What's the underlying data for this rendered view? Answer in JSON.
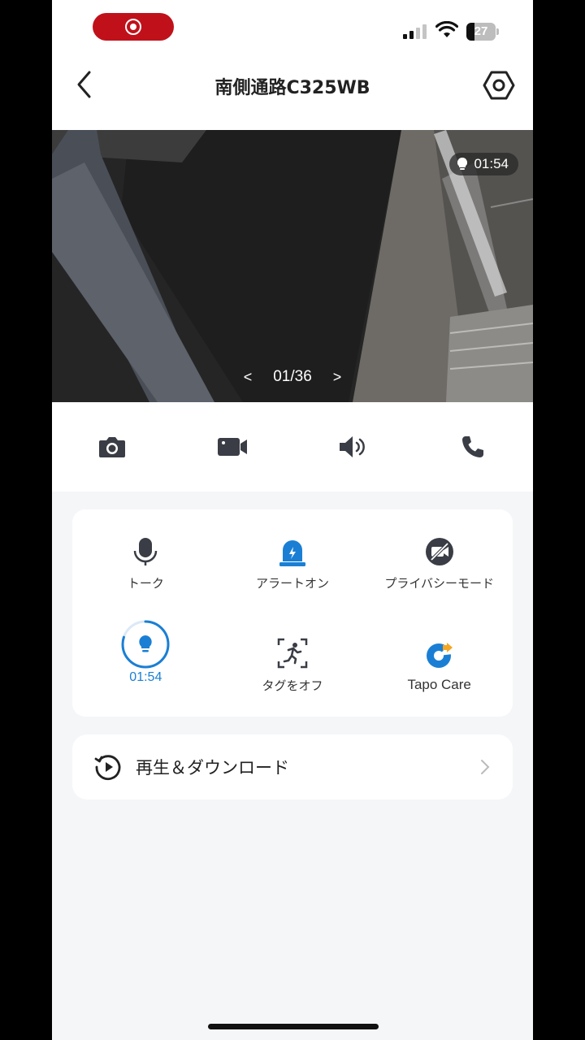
{
  "status_bar": {
    "battery": "27",
    "battery_level": 0.27
  },
  "header": {
    "title": "南側通路C325WB"
  },
  "video": {
    "time_badge": "01:54",
    "pager": {
      "prev": "<",
      "current": "01/36",
      "next": ">"
    }
  },
  "toolbar": {
    "icons": [
      "camera-icon",
      "video-camera-icon",
      "speaker-icon",
      "phone-icon"
    ]
  },
  "controls": {
    "talk": "トーク",
    "alarm": "アラートオン",
    "privacy": "プライバシーモード",
    "light_timer": "01:54",
    "light_progress": 0.8,
    "tag": "タグをオフ",
    "tapo_care": "Tapo Care"
  },
  "playback": {
    "label": "再生＆ダウンロード"
  },
  "colors": {
    "accent": "#1a7fd4",
    "record": "#c0111b",
    "tapo_orange": "#f5a623"
  }
}
